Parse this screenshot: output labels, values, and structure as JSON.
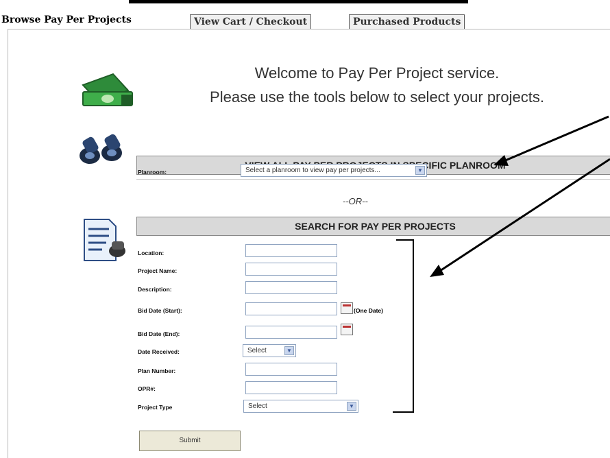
{
  "tabs": [
    {
      "label": "Browse Pay Per Projects",
      "active": true
    },
    {
      "label": "View Cart / Checkout",
      "active": false
    },
    {
      "label": "Purchased Products",
      "active": false
    }
  ],
  "welcome": {
    "line1": "Welcome to Pay Per Project service.",
    "line2": "Please use the tools below to select your projects."
  },
  "planroom_section": {
    "header": "VIEW ALL PAY PER PROJECTS IN SPECIFIC PLANROOM",
    "label": "Planroom:",
    "select_value": "Select a planroom to view pay per projects..."
  },
  "or_text": "--OR--",
  "search_section": {
    "header": "SEARCH FOR PAY PER PROJECTS",
    "fields": {
      "location": "Location:",
      "project_name": "Project Name:",
      "description": "Description:",
      "bid_start": "Bid Date (Start):",
      "one_date": "(One Date)",
      "bid_end": "Bid Date (End):",
      "date_received": "Date Received:",
      "date_received_value": "Select",
      "plan_number": "Plan Number:",
      "opr": "OPR#:",
      "project_type": "Project Type",
      "project_type_value": "Select"
    },
    "submit_label": "Submit"
  },
  "icons": [
    "money-icon",
    "binoculars-icon",
    "search-document-icon",
    "calendar-icon",
    "dropdown-arrow-icon"
  ],
  "colors": {
    "header_bg": "#d9d9d9",
    "input_border": "#8ea3c0",
    "button_bg": "#ece9d8"
  }
}
